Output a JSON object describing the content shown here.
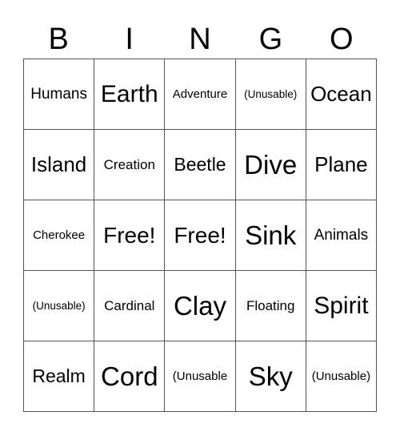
{
  "header": {
    "letters": [
      "B",
      "I",
      "N",
      "G",
      "O"
    ]
  },
  "grid": {
    "rows": [
      [
        "Humans",
        "Earth",
        "Adventure",
        "(Unusable)",
        "Ocean"
      ],
      [
        "Island",
        "Creation",
        "Beetle",
        "Dive",
        "Plane"
      ],
      [
        "Cherokee",
        "Free!",
        "Free!",
        "Sink",
        "Animals"
      ],
      [
        "(Unusable)",
        "Cardinal",
        "Clay",
        "Floating",
        "Spirit"
      ],
      [
        "Realm",
        "Cord",
        "(Unusable",
        "Sky",
        "(Unusable)"
      ]
    ]
  }
}
